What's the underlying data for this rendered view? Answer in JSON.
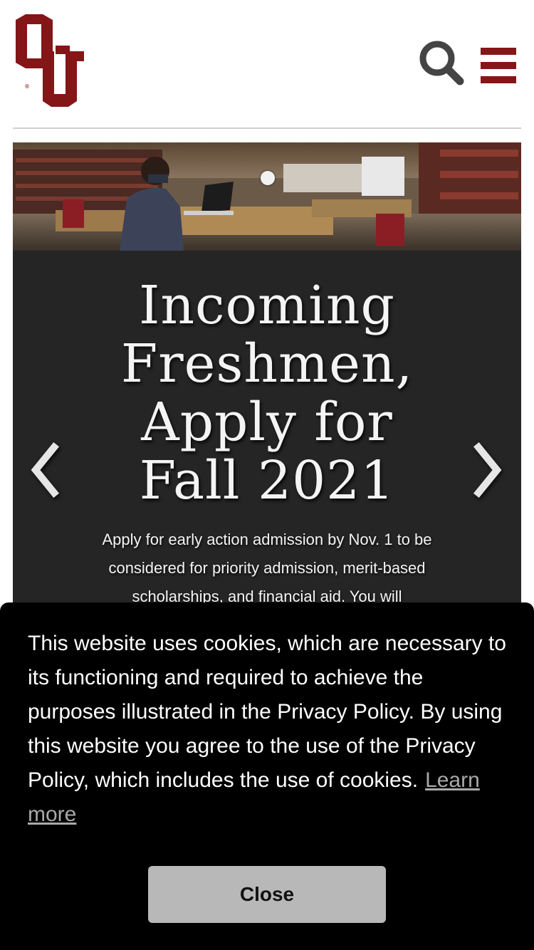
{
  "header": {
    "logo_alt": "OU",
    "brand_color": "#841617",
    "search_icon": "search-icon",
    "menu_icon": "hamburger-menu-icon"
  },
  "carousel": {
    "active_slide": 1,
    "prev_icon": "chevron-left-icon",
    "next_icon": "chevron-right-icon",
    "slide": {
      "title": "Incoming Freshmen, Apply for Fall 2021",
      "description": "Apply for early action admission by Nov. 1 to be considered for priority admission, merit-based scholarships, and financial aid. You will"
    }
  },
  "cookie_banner": {
    "message": "This website uses cookies, which are necessary to its functioning and required to achieve the purposes illustrated in the Privacy Policy. By using this website you agree to the use of the Privacy Policy, which includes the use of cookies.",
    "learn_more_label": "Learn more",
    "close_label": "Close"
  }
}
